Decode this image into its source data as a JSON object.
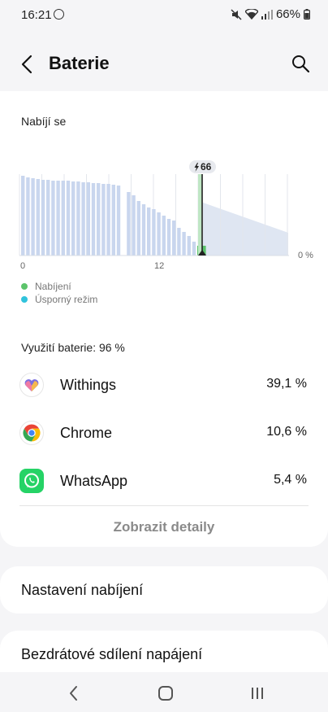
{
  "status_bar": {
    "time": "16:21",
    "battery_pct": "66%"
  },
  "header": {
    "title": "Baterie"
  },
  "charging": {
    "label": "Nabíjí se",
    "charge_badge": "66",
    "x_labels": [
      "0",
      "12"
    ],
    "y_label": "0 %"
  },
  "legend": [
    {
      "label": "Nabíjení",
      "color": "#5cc46b"
    },
    {
      "label": "Úsporný režim",
      "color": "#30c3dc"
    }
  ],
  "chart_data": {
    "type": "bar",
    "x_ticks": [
      "0",
      "12"
    ],
    "ylim": [
      0,
      100
    ],
    "y_tick_label": "0 %",
    "current_level": 66,
    "values": [
      98,
      96,
      95,
      94,
      93,
      93,
      92,
      92,
      92,
      92,
      91,
      91,
      90,
      90,
      89,
      89,
      88,
      88,
      87,
      86,
      0,
      78,
      74,
      67,
      63,
      59,
      57,
      53,
      49,
      45,
      43,
      34,
      29,
      24,
      17,
      12,
      12
    ],
    "charging_bar_indices": [
      35,
      36
    ],
    "predicted": {
      "from": 66,
      "to": 28
    }
  },
  "usage": {
    "total_label": "Využití baterie: 96 %",
    "apps": [
      {
        "name": "Withings",
        "percent": "39,1 %",
        "icon": "withings-heart-icon"
      },
      {
        "name": "Chrome",
        "percent": "10,6 %",
        "icon": "chrome-icon"
      },
      {
        "name": "WhatsApp",
        "percent": "5,4 %",
        "icon": "whatsapp-icon"
      }
    ],
    "details_button": "Zobrazit detaily"
  },
  "settings": {
    "charging_settings": "Nastavení nabíjení",
    "wireless_sharing": "Bezdrátové sdílení napájení"
  },
  "colors": {
    "bar": "#c9d6ee",
    "charging": "#5cc46b",
    "prediction": "#dfe6f2",
    "card": "#ffffff",
    "background": "#f5f5f7"
  }
}
